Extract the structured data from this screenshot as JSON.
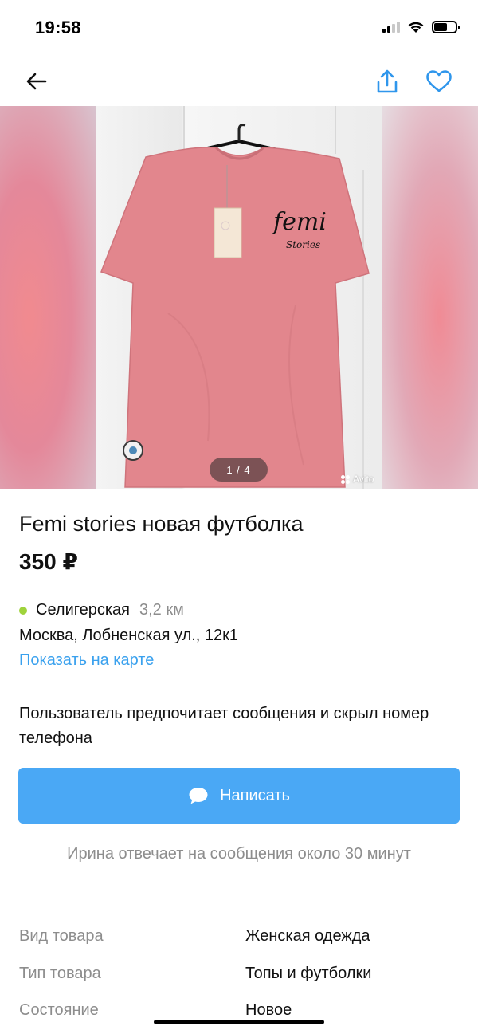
{
  "status_bar": {
    "time": "19:58"
  },
  "listing": {
    "title": "Femi stories новая футболка",
    "price": "350 ₽",
    "photo_counter": "1 / 4",
    "watermark": "Avito",
    "print_text": "femi",
    "print_subtext": "Stories"
  },
  "location": {
    "metro_station": "Селигерская",
    "metro_distance": "3,2 км",
    "metro_color": "#9fd33c",
    "address": "Москва, Лобненская ул., 12к1",
    "show_on_map": "Показать на карте"
  },
  "contact": {
    "preference_note": "Пользователь предпочитает сообщения и скрыл номер телефона",
    "write_button": "Написать",
    "reply_time_note": "Ирина отвечает на сообщения около 30 минут"
  },
  "specs": [
    {
      "label": "Вид товара",
      "value": "Женская одежда"
    },
    {
      "label": "Тип товара",
      "value": "Топы и футболки"
    },
    {
      "label": "Состояние",
      "value": "Новое"
    }
  ],
  "colors": {
    "accent": "#4aa8f5",
    "link": "#3aa1ee",
    "icon": "#2f96ec",
    "shirt": "#e2868d"
  },
  "icons": [
    "back-arrow-icon",
    "share-icon",
    "heart-icon",
    "chat-bubble-icon",
    "avito-logo-icon"
  ]
}
